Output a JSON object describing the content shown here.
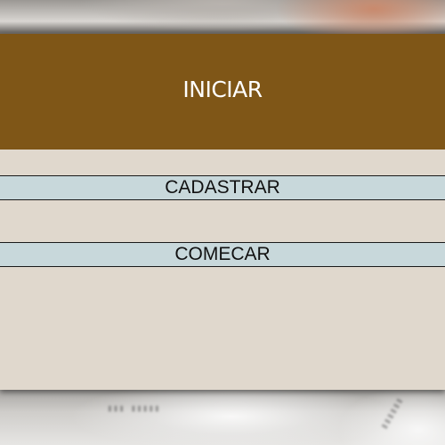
{
  "header": {
    "title": "INICIAR"
  },
  "actions": {
    "register_label": "CADASTRAR",
    "start_label": "COMECAR"
  },
  "colors": {
    "header_background": "#7f5617",
    "card_background": "#e0d8cd",
    "button_background": "#c8d8db",
    "header_text": "#ffffff",
    "button_text": "#111111"
  }
}
